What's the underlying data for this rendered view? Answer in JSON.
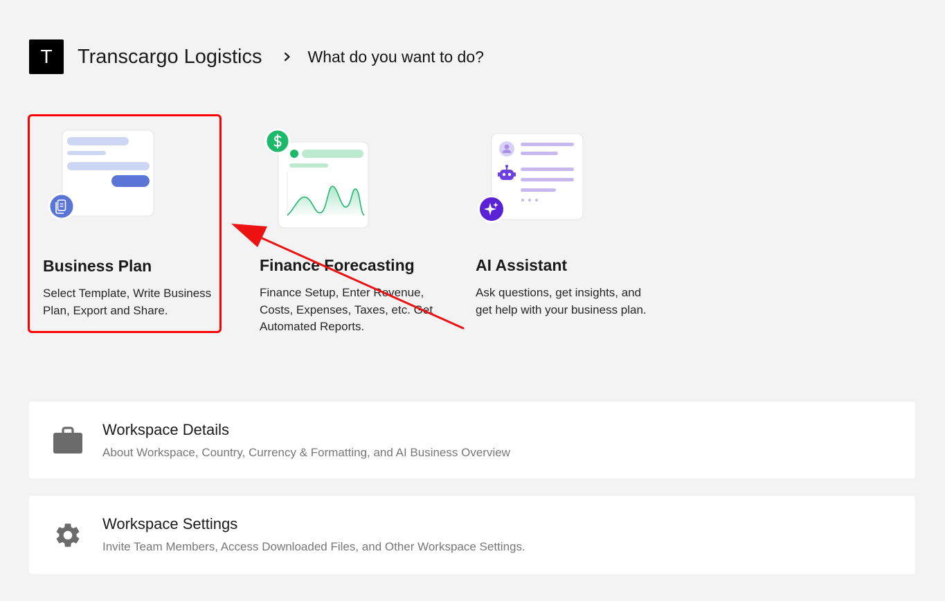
{
  "header": {
    "logo_letter": "T",
    "workspace_name": "Transcargo Logistics",
    "question": "What do you want to do?"
  },
  "options": [
    {
      "title": "Business Plan",
      "description": "Select Template, Write Business Plan, Export and Share.",
      "icon": "document-icon",
      "accent": "#5b75d6"
    },
    {
      "title": "Finance Forecasting",
      "description": "Finance Setup, Enter Revenue, Costs, Expenses, Taxes, etc. Get Automated Reports.",
      "icon": "dollar-icon",
      "accent": "#1db96a"
    },
    {
      "title": "AI Assistant",
      "description": "Ask questions, get insights, and get help with your business plan.",
      "icon": "sparkle-icon",
      "accent": "#5b21d6"
    }
  ],
  "settings": [
    {
      "title": "Workspace Details",
      "subtitle": "About Workspace, Country, Currency & Formatting, and AI Business Overview",
      "icon": "briefcase-icon"
    },
    {
      "title": "Workspace Settings",
      "subtitle": "Invite Team Members, Access Downloaded Files, and Other Workspace Settings.",
      "icon": "gear-icon"
    }
  ],
  "colors": {
    "background": "#f2f3f2",
    "highlight": "#ff0000",
    "icon_gray": "#6b6b6b"
  }
}
